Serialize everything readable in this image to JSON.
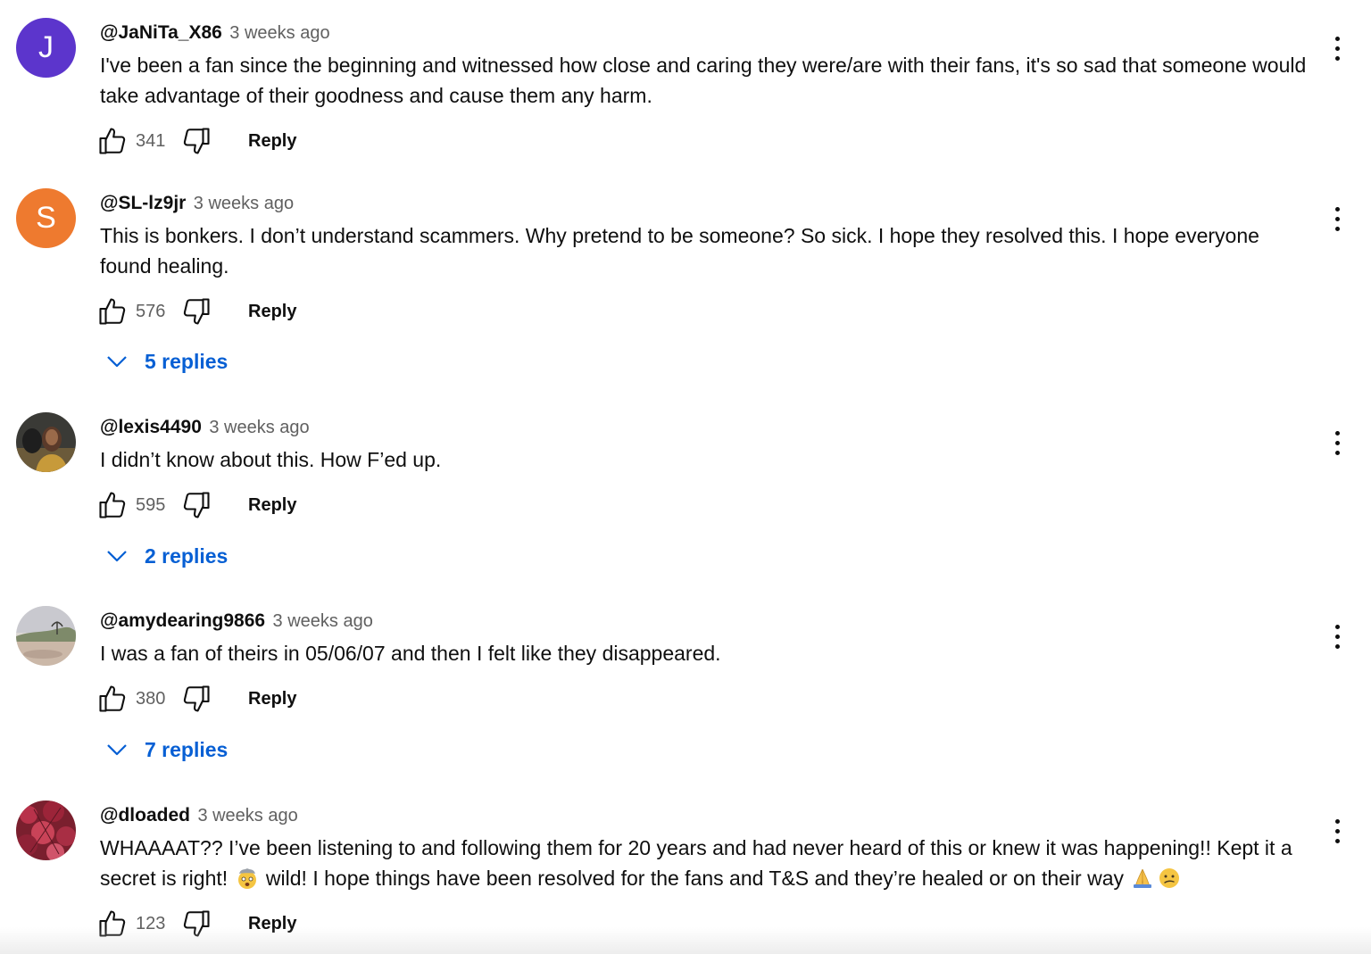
{
  "colors": {
    "reply_link": "#065fd4",
    "timestamp": "#606060",
    "avatar_j": "#5c35cc",
    "avatar_s": "#ee7a2f"
  },
  "comments": [
    {
      "author": "@JaNiTa_X86",
      "time": "3 weeks ago",
      "avatar": {
        "type": "letter",
        "letter": "J",
        "color": "#5c35cc"
      },
      "text": "I've been a fan since the beginning and  witnessed how close and caring they were/are with their fans, it's so sad that someone would take advantage of their goodness and cause them any harm.",
      "likes": "341",
      "reply_label": "Reply"
    },
    {
      "author": "@SL-lz9jr",
      "time": "3 weeks ago",
      "avatar": {
        "type": "letter",
        "letter": "S",
        "color": "#ee7a2f"
      },
      "text": "This is bonkers. I don’t understand scammers. Why pretend to be someone? So sick. I hope they resolved this. I hope everyone found healing.",
      "likes": "576",
      "reply_label": "Reply",
      "replies_label": "5 replies"
    },
    {
      "author": "@lexis4490",
      "time": "3 weeks ago",
      "avatar": {
        "type": "photo",
        "description_icon": "portrait-avatar"
      },
      "text": "I didn’t know about this. How F’ed up.",
      "likes": "595",
      "reply_label": "Reply",
      "replies_label": "2 replies"
    },
    {
      "author": "@amydearing9866",
      "time": "3 weeks ago",
      "avatar": {
        "type": "photo",
        "description_icon": "landscape-avatar"
      },
      "text": "I was a fan of theirs in 05/06/07 and then I felt like they disappeared.",
      "likes": "380",
      "reply_label": "Reply",
      "replies_label": "7 replies"
    },
    {
      "author": "@dloaded",
      "time": "3 weeks ago",
      "avatar": {
        "type": "photo",
        "description_icon": "autumn-leaves-avatar"
      },
      "text_parts": [
        "WHAAAAT?? I’ve been listening to and following them for 20 years and had never heard of this or knew it was happening!! Kept it a secret is right! ",
        " wild! I hope things have been resolved for the fans and T&S and they’re healed or on their way "
      ],
      "emojis": [
        "exploding-head-emoji",
        "folded-hands-emoji",
        "confused-face-emoji"
      ],
      "likes": "123",
      "reply_label": "Reply"
    }
  ]
}
